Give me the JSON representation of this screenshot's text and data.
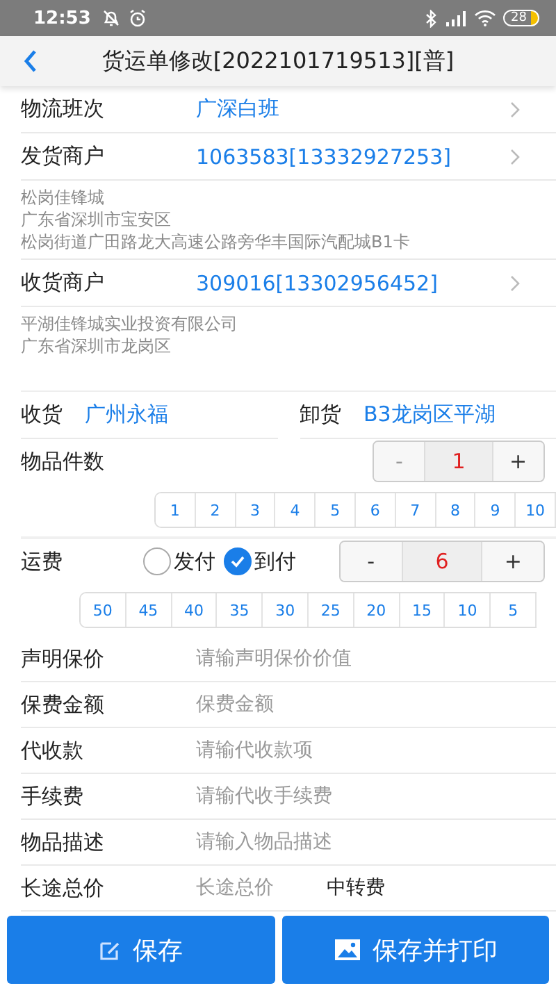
{
  "status_bar": {
    "time": "12:53",
    "battery": "28"
  },
  "header": {
    "title": "货运单修改[2022101719513][普]"
  },
  "selects": [
    {
      "label": "物流班次",
      "value": "广深白班"
    },
    {
      "label": "发货商户",
      "value": "1063583[13332927253]",
      "address": [
        "松岗佳锋城",
        "广东省深圳市宝安区",
        "松岗街道广田路龙大高速公路旁华丰国际汽配城B1卡"
      ]
    },
    {
      "label": "收货商户",
      "value": "309016[13302956452]",
      "address": [
        "平湖佳锋城实业投资有限公司",
        "广东省深圳市龙岗区"
      ]
    }
  ],
  "route": [
    {
      "label": "收货",
      "value": "广州永福"
    },
    {
      "label": "卸货",
      "value": "B3龙岗区平湖"
    }
  ],
  "pieces": {
    "label": "物品件数",
    "minus": "-",
    "minus_disabled": true,
    "value": "1",
    "plus": "+",
    "quick": [
      "1",
      "2",
      "3",
      "4",
      "5",
      "6",
      "7",
      "8",
      "9",
      "10"
    ]
  },
  "freight": {
    "label": "运费",
    "options": [
      {
        "label": "发付",
        "selected": false
      },
      {
        "label": "到付",
        "selected": true
      }
    ],
    "minus": "-",
    "minus_disabled": false,
    "value": "6",
    "plus": "+",
    "quick": [
      "50",
      "45",
      "40",
      "35",
      "30",
      "25",
      "20",
      "15",
      "10",
      "5"
    ]
  },
  "inputs": [
    {
      "label": "声明保价",
      "placeholder": "请输声明保价价值"
    },
    {
      "label": "保费金额",
      "placeholder": "保费金额"
    },
    {
      "label": "代收款",
      "placeholder": "请输代收款项"
    },
    {
      "label": "手续费",
      "placeholder": "请输代收手续费"
    },
    {
      "label": "物品描述",
      "placeholder": "请输入物品描述"
    },
    {
      "label": "长途总价",
      "placeholder": "长途总价",
      "extra_label": "中转费"
    }
  ],
  "buttons": [
    {
      "label": "保存",
      "kind": "edit"
    },
    {
      "label": "保存并打印",
      "kind": "image"
    }
  ]
}
